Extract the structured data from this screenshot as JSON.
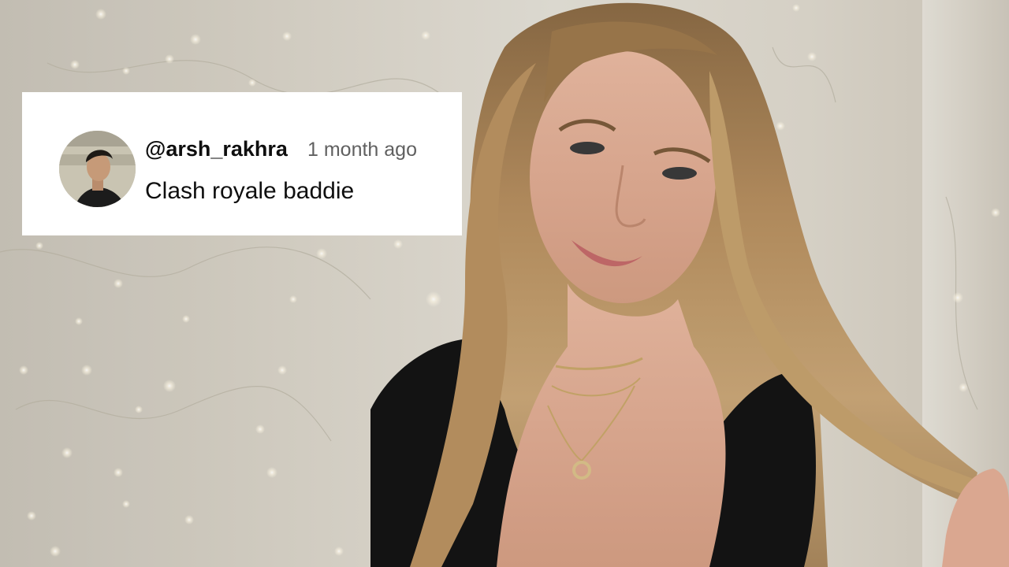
{
  "comment": {
    "avatar_icon": "user-avatar-photo",
    "handle": "@arsh_rakhra",
    "timestamp": "1 month ago",
    "text": "Clash royale baddie"
  },
  "colors": {
    "card_background": "#ffffff",
    "handle_color": "#0f0f0f",
    "timestamp_color": "#606060",
    "text_color": "#0f0f0f"
  }
}
